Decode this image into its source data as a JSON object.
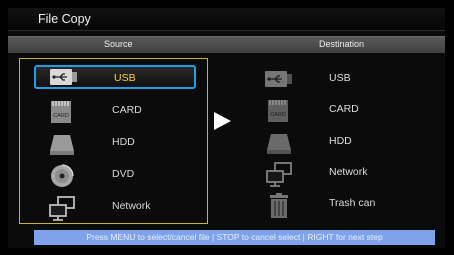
{
  "window": {
    "title": "File Copy"
  },
  "columns": {
    "source": "Source",
    "destination": "Destination"
  },
  "source_items": [
    {
      "label": "USB",
      "icon": "usb-icon",
      "selected": true
    },
    {
      "label": "CARD",
      "icon": "card-icon"
    },
    {
      "label": "HDD",
      "icon": "hdd-icon"
    },
    {
      "label": "DVD",
      "icon": "dvd-icon"
    },
    {
      "label": "Network",
      "icon": "network-icon"
    }
  ],
  "destination_items": [
    {
      "label": "USB",
      "icon": "usb-icon"
    },
    {
      "label": "CARD",
      "icon": "card-icon"
    },
    {
      "label": "HDD",
      "icon": "hdd-icon"
    },
    {
      "label": "Network",
      "icon": "network-icon"
    },
    {
      "label": "Trash can",
      "icon": "trash-can-icon"
    }
  ],
  "card_icon_text": "CARD",
  "status": {
    "hint": "Press MENU to select/cancel file | STOP to cancel select | RIGHT for next step"
  },
  "colors": {
    "selection": "#1e9fe6",
    "panel_border": "#c9b52a",
    "status_bar": "#7fa2ea",
    "selected_label": "#ffd43a"
  }
}
